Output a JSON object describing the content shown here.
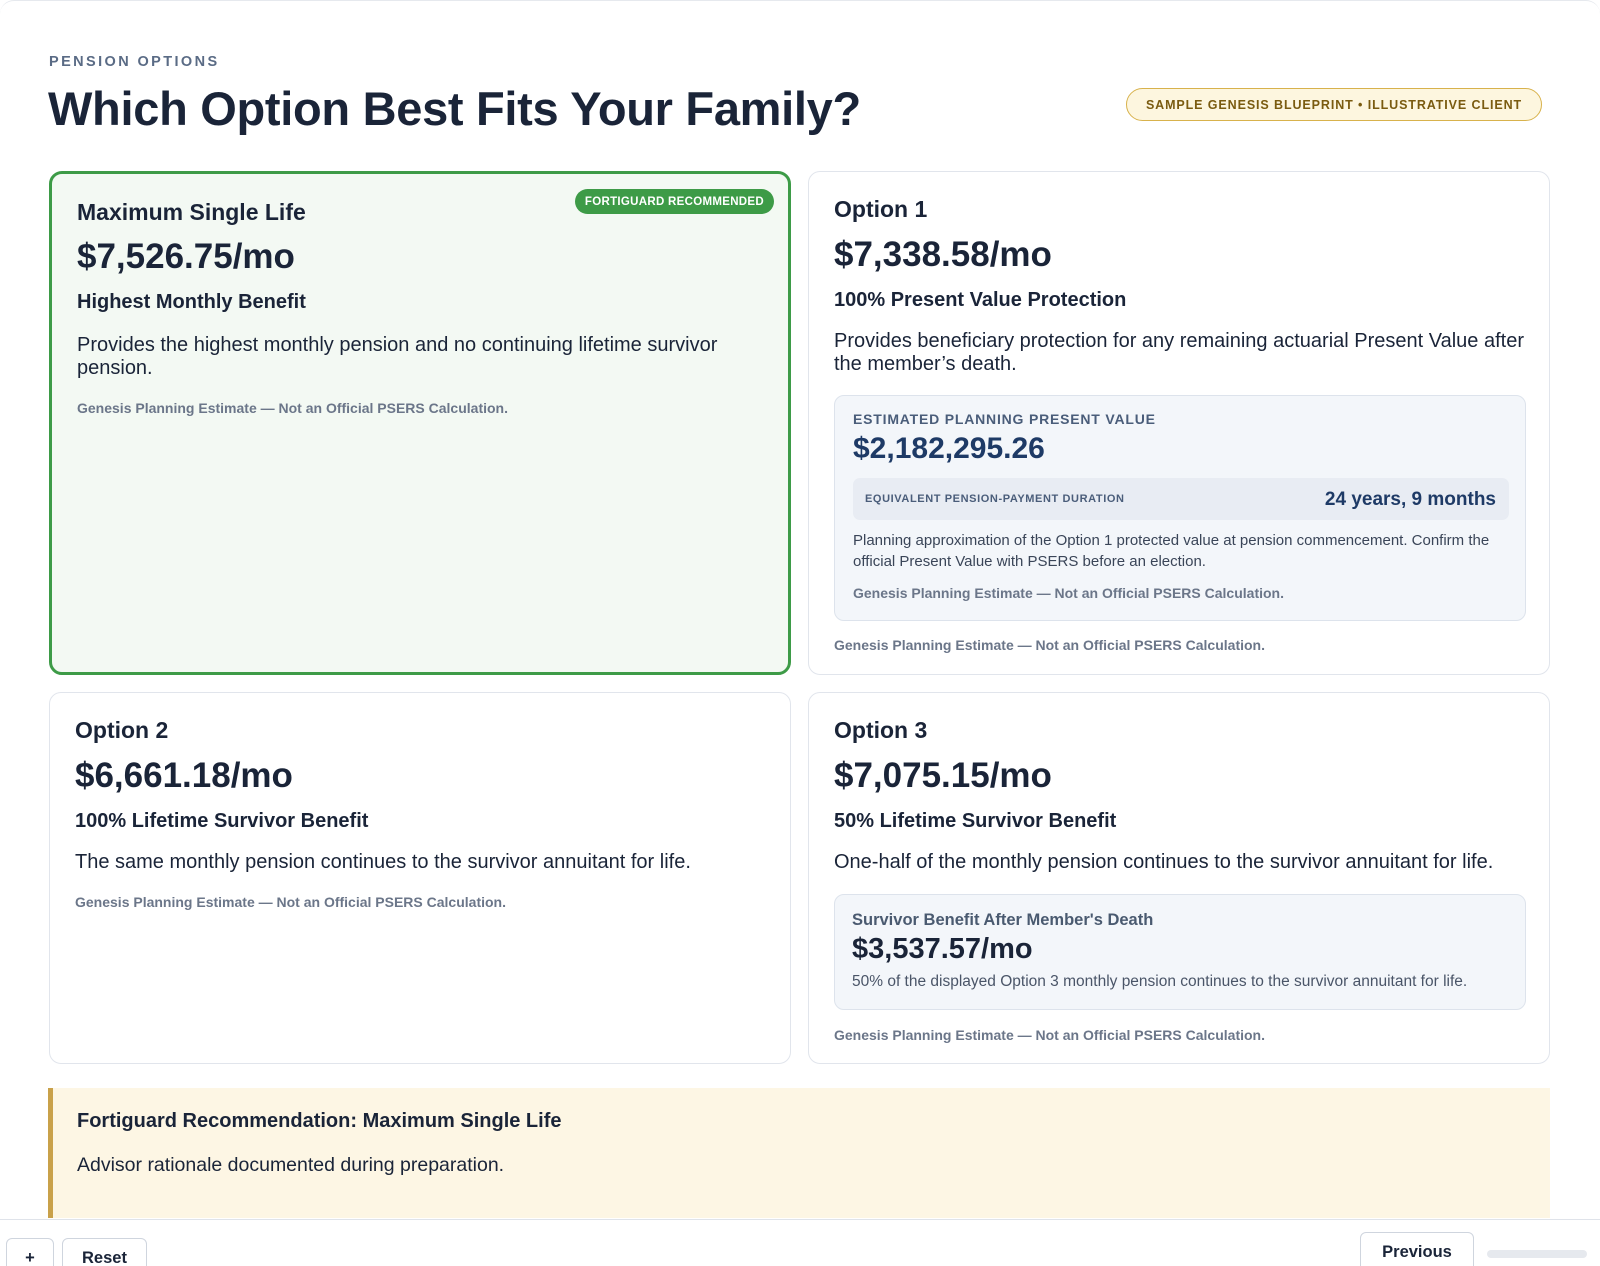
{
  "header": {
    "eyebrow": "PENSION OPTIONS",
    "title": "Which Option Best Fits Your Family?",
    "sample_badge": "SAMPLE GENESIS BLUEPRINT • ILLUSTRATIVE CLIENT"
  },
  "disclaimer_text": "Genesis Planning Estimate — Not an Official PSERS Calculation.",
  "options": {
    "max_single_life": {
      "badge": "FORTIGUARD RECOMMENDED",
      "title": "Maximum Single Life",
      "amount": "$7,526.75/mo",
      "subtitle": "Highest Monthly Benefit",
      "description": "Provides the highest monthly pension and no continuing lifetime survivor pension."
    },
    "option1": {
      "title": "Option 1",
      "amount": "$7,338.58/mo",
      "subtitle": "100% Present Value Protection",
      "description": "Provides beneficiary protection for any remaining actuarial Present Value after the member’s death.",
      "present_value": {
        "label": "ESTIMATED PLANNING PRESENT VALUE",
        "amount": "$2,182,295.26",
        "duration_label": "EQUIVALENT PENSION-PAYMENT DURATION",
        "duration_value": "24 years, 9 months",
        "note": "Planning approximation of the Option 1 protected value at pension commencement. Confirm the official Present Value with PSERS before an election."
      }
    },
    "option2": {
      "title": "Option 2",
      "amount": "$6,661.18/mo",
      "subtitle": "100% Lifetime Survivor Benefit",
      "description": "The same monthly pension continues to the survivor annuitant for life."
    },
    "option3": {
      "title": "Option 3",
      "amount": "$7,075.15/mo",
      "subtitle": "50% Lifetime Survivor Benefit",
      "description": "One-half of the monthly pension continues to the survivor annuitant for life.",
      "survivor": {
        "label": "Survivor Benefit After Member's Death",
        "amount": "$3,537.57/mo",
        "note": "50% of the displayed Option 3 monthly pension continues to the survivor annuitant for life."
      }
    }
  },
  "recommendation": {
    "title": "Fortiguard Recommendation: Maximum Single Life",
    "text": "Advisor rationale documented during preparation."
  },
  "footer": {
    "add_label": "+",
    "reset_label": "Reset",
    "previous_label": "Previous"
  },
  "colors": {
    "recommended_green": "#3d9b47",
    "navy": "#1a2438",
    "gold_accent": "#c9a14a"
  }
}
